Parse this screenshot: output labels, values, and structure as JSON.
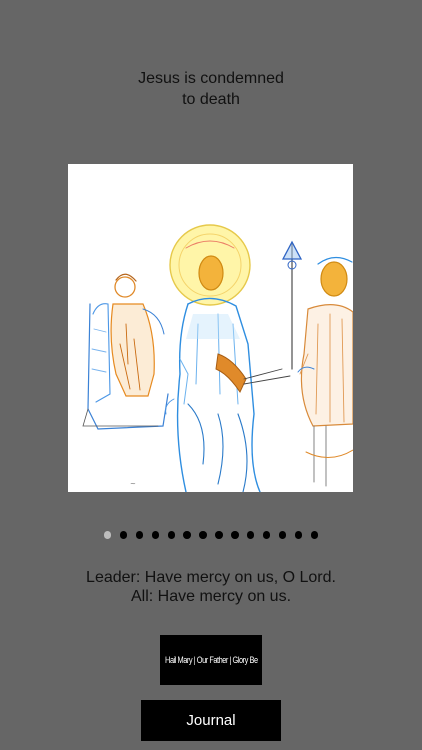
{
  "station": {
    "title": "Jesus is condemned\nto death"
  },
  "artwork": {
    "name": "station-artwork"
  },
  "pager": {
    "count": 14,
    "current_page": 1
  },
  "response": {
    "leader": "Leader: Have mercy on us, O Lord.",
    "all": "All: Have mercy on us."
  },
  "buttons": {
    "prayers_label": "Hail Mary | Our Father | Glory Be",
    "journal_label": "Journal"
  },
  "colors": {
    "background": "#666666",
    "button_bg": "#000000",
    "button_text": "#ffffff",
    "dot_active": "#bdbdbd",
    "dot_inactive": "#000000"
  }
}
